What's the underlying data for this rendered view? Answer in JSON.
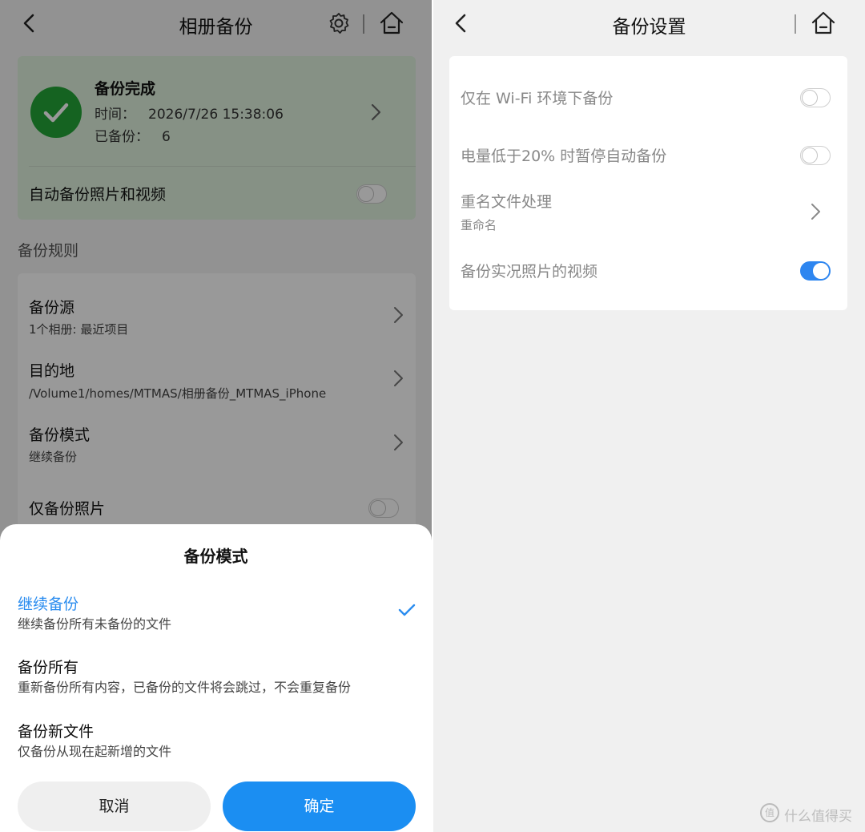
{
  "left": {
    "header": {
      "title": "相册备份"
    },
    "status": {
      "title": "备份完成",
      "time_label": "时间：",
      "time_value": "2026/7/26 15:38:06",
      "count_label": "已备份：",
      "count_value": "6",
      "auto_label": "自动备份照片和视频",
      "auto_on": false
    },
    "rules_section_title": "备份规则",
    "rules": [
      {
        "label": "备份源",
        "sub": "1个相册: 最近项目"
      },
      {
        "label": "目的地",
        "sub": "/Volume1/homes/MTMAS/相册备份_MTMAS_iPhone"
      },
      {
        "label": "备份模式",
        "sub": "继续备份"
      }
    ],
    "photos_only": {
      "label": "仅备份照片",
      "on": false
    }
  },
  "sheet": {
    "title": "备份模式",
    "options": [
      {
        "title": "继续备份",
        "desc": "继续备份所有未备份的文件",
        "selected": true
      },
      {
        "title": "备份所有",
        "desc": "重新备份所有内容，已备份的文件将会跳过，不会重复备份",
        "selected": false
      },
      {
        "title": "备份新文件",
        "desc": "仅备份从现在起新增的文件",
        "selected": false
      }
    ],
    "cancel_label": "取消",
    "confirm_label": "确定"
  },
  "right": {
    "header": {
      "title": "备份设置"
    },
    "settings": [
      {
        "label": "仅在 Wi-Fi 环境下备份",
        "on": false
      },
      {
        "label": "电量低于20% 时暂停自动备份",
        "on": false
      },
      {
        "label": "重名文件处理",
        "sub": "重命名"
      },
      {
        "label": "备份实况照片的视频",
        "on": true
      }
    ]
  },
  "watermark": {
    "text": "什么值得买",
    "glyph": "值"
  },
  "colors": {
    "accent": "#1b8ef2",
    "success": "#23a637",
    "status_bg": "#dff2de"
  }
}
